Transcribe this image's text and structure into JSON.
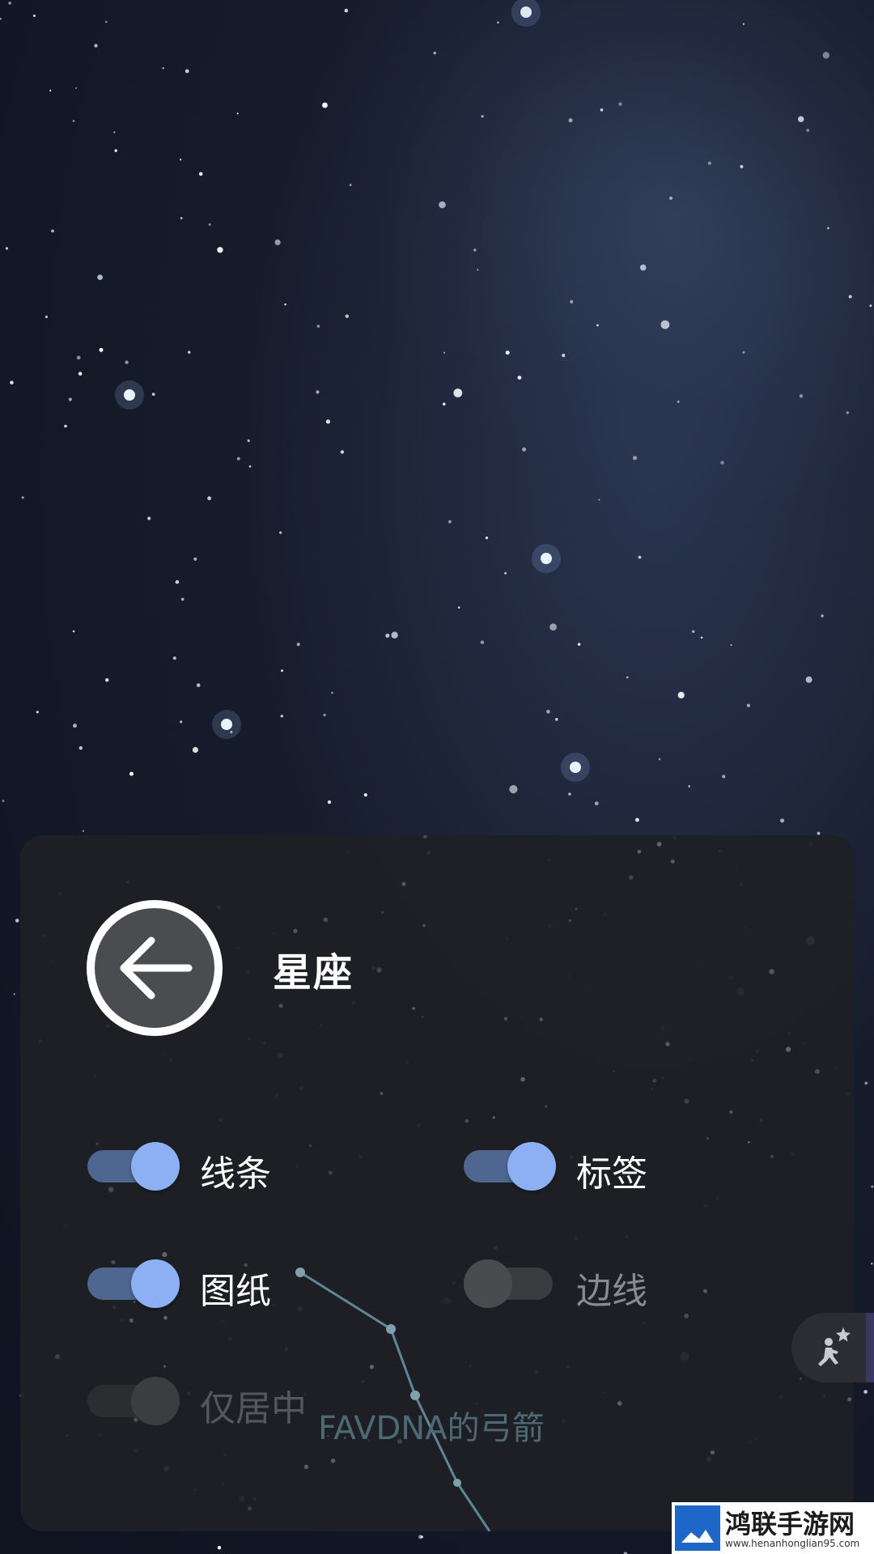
{
  "panel": {
    "title": "星座",
    "toggles": [
      {
        "label": "线条",
        "state": "on"
      },
      {
        "label": "标签",
        "state": "on"
      },
      {
        "label": "图纸",
        "state": "on"
      },
      {
        "label": "边线",
        "state": "off"
      },
      {
        "label": "仅居中",
        "state": "disabled"
      }
    ],
    "constellation_label": "FAVDNA的弓箭"
  },
  "fab": {
    "icon": "stargazer-run-icon"
  },
  "watermark": {
    "title": "鸿联手游网",
    "url": "www.henanhonglian95.com"
  },
  "colors": {
    "toggle_on_knob": "#8db0f5",
    "toggle_on_track": "#4f6790",
    "panel_bg": "#1e2024",
    "constellation_line": "#5d8797"
  }
}
